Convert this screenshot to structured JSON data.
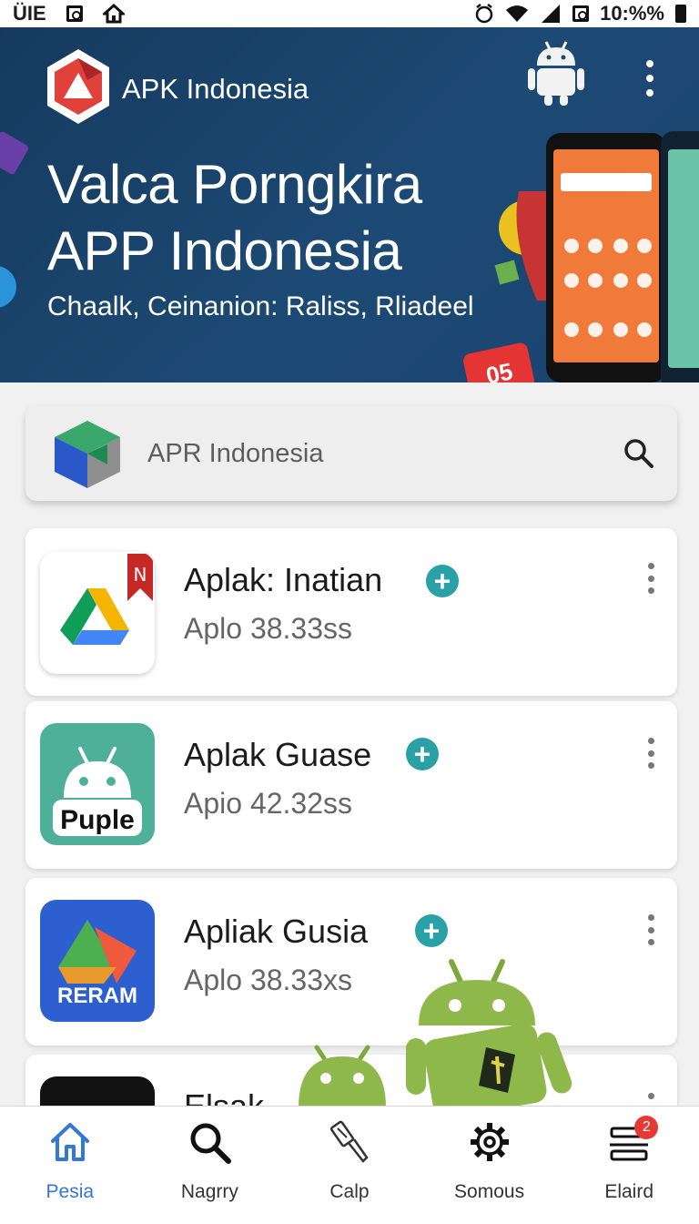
{
  "status_bar": {
    "left_text": "ÜIE",
    "time": "10:%%"
  },
  "hero": {
    "brand": "APK Indonesia",
    "title_line1": "Valca Porngkira",
    "title_line2": "APP Indonesia",
    "subtitle": "Chaalk, Ceinanion: Raliss, Rliadeel",
    "badge": "05"
  },
  "search": {
    "placeholder": "APR Indonesia"
  },
  "apps": [
    {
      "name": "Aplak: Inatian",
      "meta": "Aplo 38.33ss"
    },
    {
      "name": "Aplak Guase",
      "meta": "Apio 42.32ss",
      "icon_text": "Puple"
    },
    {
      "name": "Apliak Gusia",
      "meta": "Aplo 38.33xs",
      "icon_text": "RERAM"
    },
    {
      "name": "Elsak"
    }
  ],
  "nav": {
    "items": [
      {
        "label": "Pesia",
        "icon": "home-icon"
      },
      {
        "label": "Nagrry",
        "icon": "search-icon"
      },
      {
        "label": "Calp",
        "icon": "brush-icon"
      },
      {
        "label": "Somous",
        "icon": "gear-icon"
      },
      {
        "label": "Elaird",
        "icon": "list-icon",
        "badge": "2"
      }
    ]
  },
  "colors": {
    "hero_bg": "#1c4a74",
    "accent_teal": "#2aa0a7",
    "active_nav": "#3478d6",
    "badge_red": "#e53935"
  }
}
